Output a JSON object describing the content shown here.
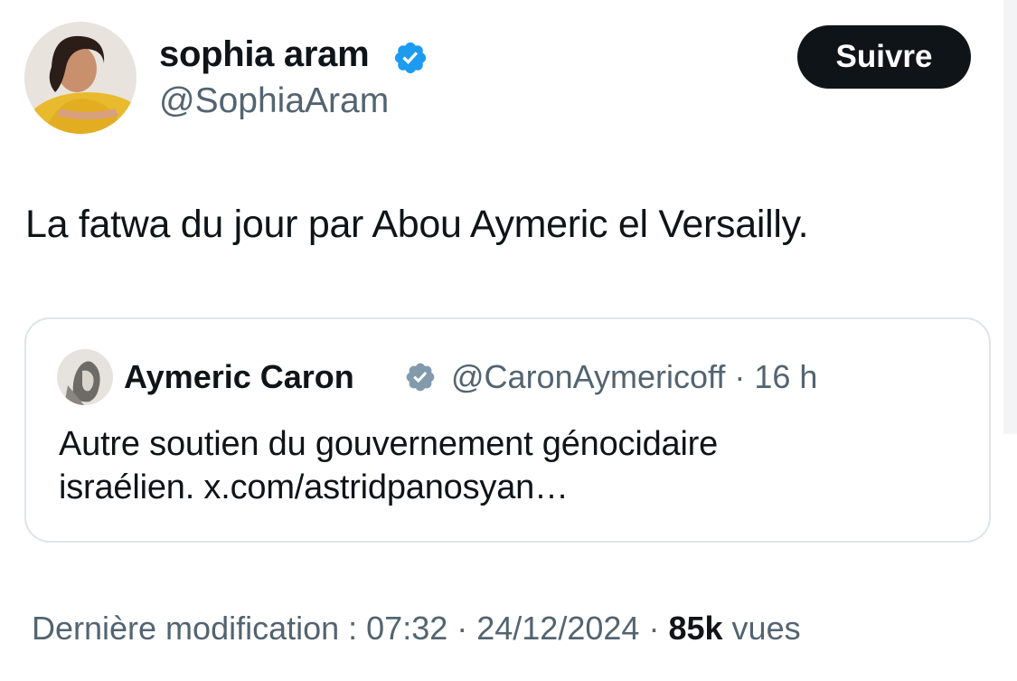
{
  "tweet": {
    "author": {
      "name": "sophia aram",
      "handle": "@SophiaAram",
      "verified": true
    },
    "follow_label": "Suivre",
    "text": "La fatwa du jour par Abou Aymeric el Versailly.",
    "quote": {
      "author_name": "Aymeric Caron",
      "handle": "@CaronAymericoff",
      "separator": "·",
      "time": "16 h",
      "verified": true,
      "body_lines": [
        "Autre soutien du gouvernement génocidaire",
        "israélien. x.com/astridpanosyan…"
      ]
    },
    "footer": {
      "edited_label": "Dernière modification : 07:32 · 24/12/2024",
      "separator": "·",
      "views_count": "85k",
      "views_label": "vues"
    }
  },
  "colors": {
    "text_primary": "#0f1419",
    "text_secondary": "#536471",
    "verified_badge": "#1d9bf0",
    "verified_badge_gray": "#829aab",
    "follow_button_bg": "#0f1419",
    "card_border": "#dfe4e8"
  },
  "icons": {
    "verified": "verified-badge-icon",
    "verified_gray": "verified-badge-gray-icon"
  }
}
